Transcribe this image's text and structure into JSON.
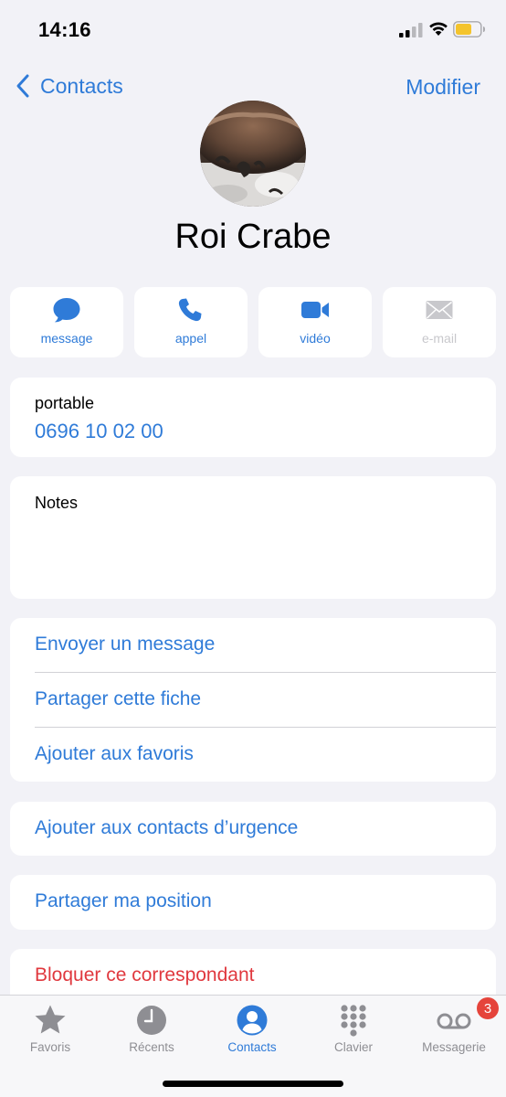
{
  "status_bar": {
    "time": "14:16"
  },
  "nav": {
    "back_label": "Contacts",
    "edit_label": "Modifier"
  },
  "contact": {
    "name": "Roi Crabe"
  },
  "actions": [
    {
      "label": "message",
      "icon": "message-bubble-icon",
      "enabled": true
    },
    {
      "label": "appel",
      "icon": "phone-icon",
      "enabled": true
    },
    {
      "label": "vidéo",
      "icon": "video-camera-icon",
      "enabled": true
    },
    {
      "label": "e-mail",
      "icon": "envelope-icon",
      "enabled": false
    }
  ],
  "phone": {
    "type": "portable",
    "number": "0696 10 02 00"
  },
  "notes": {
    "label": "Notes",
    "value": ""
  },
  "options": [
    "Envoyer un message",
    "Partager cette fiche",
    "Ajouter aux favoris"
  ],
  "emergency": {
    "label": "Ajouter aux contacts d’urgence"
  },
  "share_location": {
    "label": "Partager ma position"
  },
  "block": {
    "label": "Bloquer ce correspondant"
  },
  "tabs": [
    {
      "label": "Favoris",
      "icon": "star-icon",
      "active": false
    },
    {
      "label": "Récents",
      "icon": "clock-icon",
      "active": false
    },
    {
      "label": "Contacts",
      "icon": "person-circle-icon",
      "active": true
    },
    {
      "label": "Clavier",
      "icon": "keypad-icon",
      "active": false
    },
    {
      "label": "Messagerie",
      "icon": "voicemail-icon",
      "active": false,
      "badge": "3"
    }
  ],
  "colors": {
    "accent": "#2f7bd8",
    "destructive": "#e0383e",
    "background": "#f2f2f7",
    "badge": "#e5443b"
  }
}
